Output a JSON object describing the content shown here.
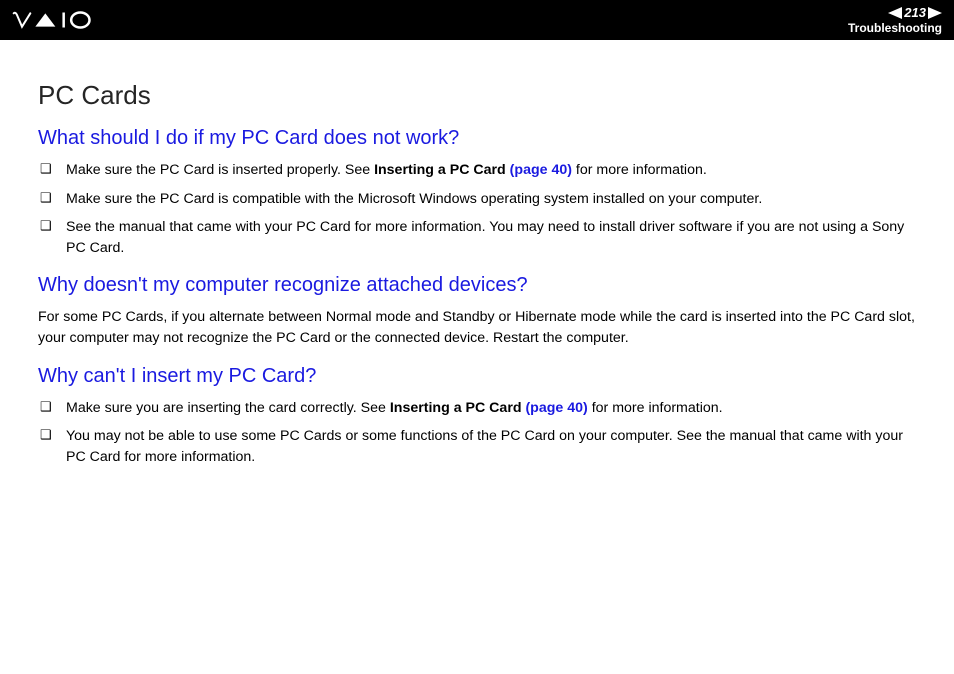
{
  "header": {
    "page_number": "213",
    "section": "Troubleshooting"
  },
  "title": "PC Cards",
  "q1": {
    "heading": "What should I do if my PC Card does not work?",
    "items": {
      "i1_pre": "Make sure the PC Card is inserted properly. See ",
      "i1_bold": "Inserting a PC Card ",
      "i1_link": "(page 40)",
      "i1_post": " for more information.",
      "i2": "Make sure the PC Card is compatible with the Microsoft Windows operating system installed on your computer.",
      "i3": "See the manual that came with your PC Card for more information. You may need to install driver software if you are not using a Sony PC Card."
    }
  },
  "q2": {
    "heading": "Why doesn't my computer recognize attached devices?",
    "para": "For some PC Cards, if you alternate between Normal mode and Standby or Hibernate mode while the card is inserted into the PC Card slot, your computer may not recognize the PC Card or the connected device. Restart the computer."
  },
  "q3": {
    "heading": "Why can't I insert my PC Card?",
    "items": {
      "i1_pre": "Make sure you are inserting the card correctly. See ",
      "i1_bold": "Inserting a PC Card ",
      "i1_link": "(page 40)",
      "i1_post": " for more information.",
      "i2": "You may not be able to use some PC Cards or some functions of the PC Card on your computer. See the manual that came with your PC Card for more information."
    }
  }
}
